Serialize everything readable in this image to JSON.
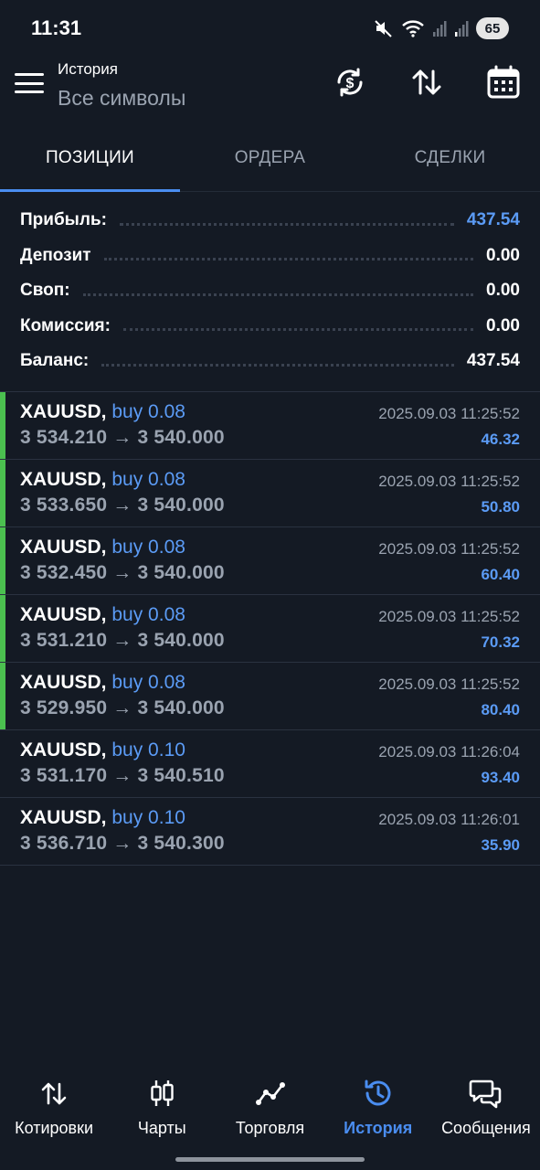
{
  "status_bar": {
    "time": "11:31",
    "battery": "65"
  },
  "header": {
    "subtitle": "История",
    "title": "Все символы"
  },
  "tabs": [
    {
      "label": "ПОЗИЦИИ",
      "active": true
    },
    {
      "label": "ОРДЕРА",
      "active": false
    },
    {
      "label": "СДЕЛКИ",
      "active": false
    }
  ],
  "summary": {
    "profit_label": "Прибыль:",
    "profit_value": "437.54",
    "deposit_label": "Депозит",
    "deposit_value": "0.00",
    "swap_label": "Своп:",
    "swap_value": "0.00",
    "commission_label": "Комиссия:",
    "commission_value": "0.00",
    "balance_label": "Баланс:",
    "balance_value": "437.54"
  },
  "positions": [
    {
      "symbol": "XAUUSD,",
      "side": "buy 0.08",
      "prices": "3 534.210 → 3 540.000",
      "time": "2025.09.03 11:25:52",
      "profit": "46.32"
    },
    {
      "symbol": "XAUUSD,",
      "side": "buy 0.08",
      "prices": "3 533.650 → 3 540.000",
      "time": "2025.09.03 11:25:52",
      "profit": "50.80"
    },
    {
      "symbol": "XAUUSD,",
      "side": "buy 0.08",
      "prices": "3 532.450 → 3 540.000",
      "time": "2025.09.03 11:25:52",
      "profit": "60.40"
    },
    {
      "symbol": "XAUUSD,",
      "side": "buy 0.08",
      "prices": "3 531.210 → 3 540.000",
      "time": "2025.09.03 11:25:52",
      "profit": "70.32"
    },
    {
      "symbol": "XAUUSD,",
      "side": "buy 0.08",
      "prices": "3 529.950 → 3 540.000",
      "time": "2025.09.03 11:25:52",
      "profit": "80.40"
    },
    {
      "symbol": "XAUUSD,",
      "side": "buy 0.10",
      "prices": "3 531.170 → 3 540.510",
      "time": "2025.09.03 11:26:04",
      "profit": "93.40"
    },
    {
      "symbol": "XAUUSD,",
      "side": "buy 0.10",
      "prices": "3 536.710 → 3 540.300",
      "time": "2025.09.03 11:26:01",
      "profit": "35.90"
    }
  ],
  "bottom_nav": [
    {
      "label": "Котировки",
      "icon": "quotes-arrows-icon",
      "active": false
    },
    {
      "label": "Чарты",
      "icon": "candlestick-chart-icon",
      "active": false
    },
    {
      "label": "Торговля",
      "icon": "trade-line-icon",
      "active": false
    },
    {
      "label": "История",
      "icon": "history-clock-icon",
      "active": true
    },
    {
      "label": "Сообщения",
      "icon": "chat-bubbles-icon",
      "active": false
    }
  ],
  "colors": {
    "background": "#141a24",
    "accent": "#4a8df0",
    "profit": "#5b9bf5",
    "open_marker": "#4bc04f",
    "muted_text": "#9aa3b0"
  }
}
